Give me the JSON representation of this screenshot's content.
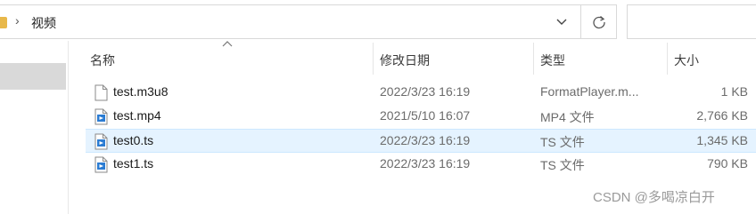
{
  "address": {
    "crumb": "视频"
  },
  "columns": {
    "name": "名称",
    "date": "修改日期",
    "type": "类型",
    "size": "大小"
  },
  "files": [
    {
      "name": "test.m3u8",
      "date": "2022/3/23 16:19",
      "type": "FormatPlayer.m...",
      "size": "1 KB",
      "icon": "blank-file-icon",
      "selected": false
    },
    {
      "name": "test.mp4",
      "date": "2021/5/10 16:07",
      "type": "MP4 文件",
      "size": "2,766 KB",
      "icon": "media-file-icon",
      "selected": false
    },
    {
      "name": "test0.ts",
      "date": "2022/3/23 16:19",
      "type": "TS 文件",
      "size": "1,345 KB",
      "icon": "media-file-icon",
      "selected": true
    },
    {
      "name": "test1.ts",
      "date": "2022/3/23 16:19",
      "type": "TS 文件",
      "size": "790 KB",
      "icon": "media-file-icon",
      "selected": false
    }
  ],
  "watermark": "CSDN @多喝凉白开",
  "colors": {
    "selection": "#e5f3ff",
    "selectionBorder": "#cce8ff",
    "folder": "#e8b84a",
    "mediaIcon": "#2b7cd3"
  }
}
